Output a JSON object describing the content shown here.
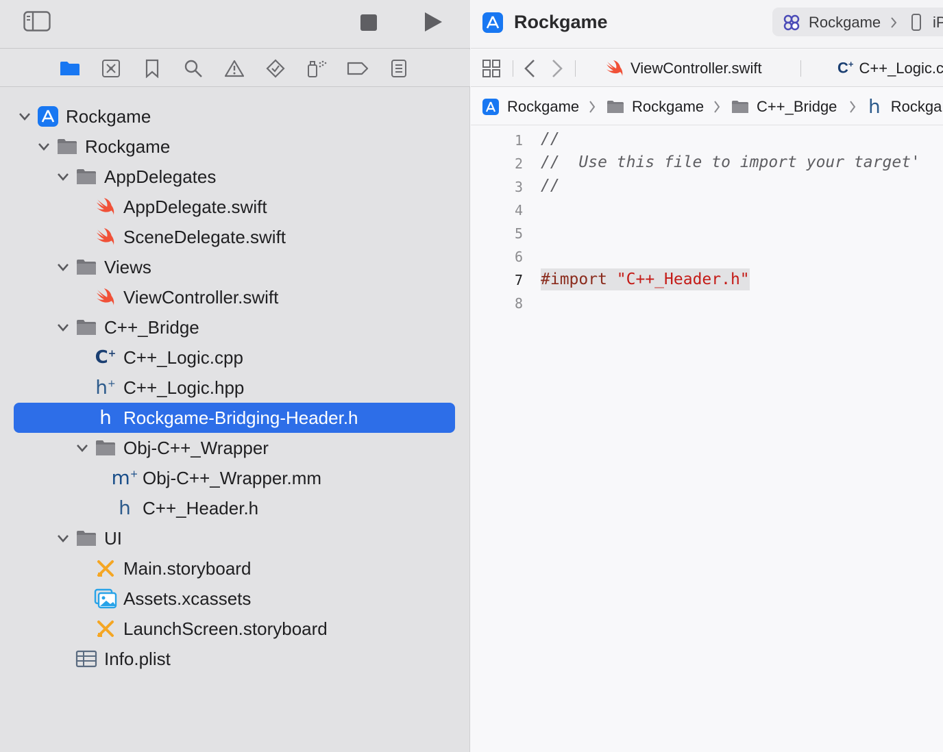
{
  "sidebar": {
    "tree": [
      {
        "label": "Rockgame",
        "type": "project",
        "expanded": true
      },
      {
        "label": "Rockgame",
        "type": "folder",
        "expanded": true
      },
      {
        "label": "AppDelegates",
        "type": "folder",
        "expanded": true
      },
      {
        "label": "AppDelegate.swift",
        "type": "swift"
      },
      {
        "label": "SceneDelegate.swift",
        "type": "swift"
      },
      {
        "label": "Views",
        "type": "folder",
        "expanded": true
      },
      {
        "label": "ViewController.swift",
        "type": "swift"
      },
      {
        "label": "C++_Bridge",
        "type": "folder",
        "expanded": true
      },
      {
        "label": "C++_Logic.cpp",
        "type": "cpp"
      },
      {
        "label": "C++_Logic.hpp",
        "type": "hpp"
      },
      {
        "label": "Rockgame-Bridging-Header.h",
        "type": "header",
        "selected": true
      },
      {
        "label": "Obj-C++_Wrapper",
        "type": "folder",
        "expanded": true
      },
      {
        "label": "Obj-C++_Wrapper.mm",
        "type": "mm"
      },
      {
        "label": "C++_Header.h",
        "type": "header"
      },
      {
        "label": "UI",
        "type": "folder",
        "expanded": true
      },
      {
        "label": "Main.storyboard",
        "type": "storyboard"
      },
      {
        "label": "Assets.xcassets",
        "type": "assets"
      },
      {
        "label": "LaunchScreen.storyboard",
        "type": "storyboard"
      },
      {
        "label": "Info.plist",
        "type": "plist"
      }
    ]
  },
  "editor": {
    "app_title": "Rockgame",
    "scheme": {
      "name": "Rockgame",
      "device": "iP"
    },
    "tabs": [
      {
        "label": "ViewController.swift",
        "icon": "swift-icon"
      },
      {
        "label": "C++_Logic.c",
        "icon": "cpp-icon"
      }
    ],
    "breadcrumb": [
      "Rockgame",
      "Rockgame",
      "C++_Bridge",
      "Rockga"
    ],
    "code": {
      "current_line": "7",
      "line_numbers": [
        "1",
        "2",
        "3",
        "4",
        "5",
        "6",
        "7",
        "8"
      ],
      "lines": {
        "l1": "//",
        "l2": "//  Use this file to import your target'",
        "l3": "//",
        "l7_keyword": "#import",
        "l7_string": "\"C++_Header.h\""
      }
    }
  },
  "colors": {
    "selection": "#2d6ee8",
    "swift": "#f05138",
    "storyboard": "#f5a623",
    "accent": "#1877f2"
  }
}
